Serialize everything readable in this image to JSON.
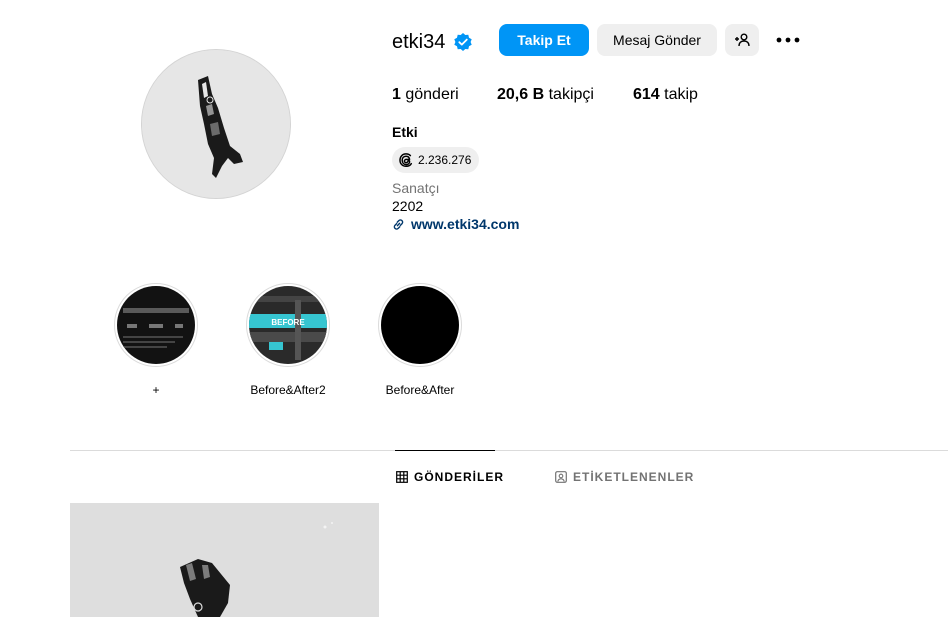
{
  "profile": {
    "username": "etki34",
    "follow_label": "Takip Et",
    "message_label": "Mesaj Gönder",
    "full_name": "Etki",
    "threads_count": "2.236.276",
    "category": "Sanatçı",
    "bio": "2202",
    "link": "www.etki34.com"
  },
  "stats": {
    "posts_value": "1",
    "posts_label": "gönderi",
    "followers_value": "20,6 B",
    "followers_label": "takipçi",
    "following_value": "614",
    "following_label": "takip"
  },
  "highlights": [
    {
      "label": "+"
    },
    {
      "label": "Before&After2",
      "overlay_text": "BEFORE"
    },
    {
      "label": "Before&After"
    }
  ],
  "tabs": [
    {
      "label": "GÖNDERİLER",
      "active": true
    },
    {
      "label": "ETİKETLENENLER",
      "active": false
    }
  ],
  "colors": {
    "accent": "#0095f6",
    "button_gray": "#efefef",
    "link": "#00376b",
    "muted": "#737373",
    "verified": "#0095f6"
  },
  "icons": {
    "verified": "verified-badge-icon",
    "suggest": "add-person-icon",
    "more": "more-options-icon",
    "threads": "threads-icon",
    "link": "link-icon",
    "posts_tab": "grid-icon",
    "tagged_tab": "tagged-person-icon"
  }
}
